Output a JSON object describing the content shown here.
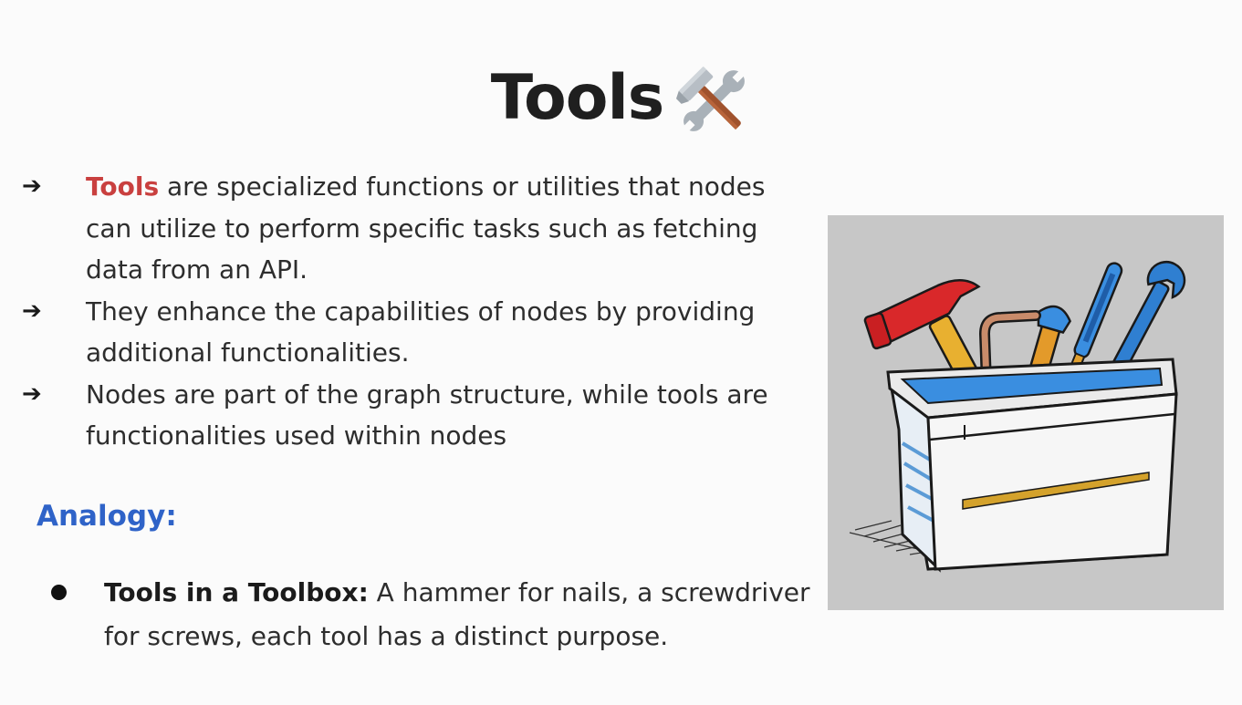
{
  "slide": {
    "title": "Tools",
    "title_icon": "hammer-and-wrench-icon",
    "bullets": [
      {
        "highlight": "Tools",
        "text": " are specialized functions or utilities that nodes can utilize to perform specific tasks such as fetching data from an API."
      },
      {
        "text": "They enhance the capabilities of nodes by providing additional functionalities."
      },
      {
        "text": "Nodes are part of the graph structure, while tools are functionalities used within nodes"
      }
    ],
    "bullet_marker": "➔",
    "analogy": {
      "heading": "Analogy",
      "colon": ":",
      "items": [
        {
          "term": "Tools in a Toolbox",
          "separator": ":",
          "text": " A hammer for nails, a screwdriver for screws, each tool has a distinct purpose."
        }
      ]
    },
    "image": {
      "subject": "toolbox-illustration"
    },
    "colors": {
      "highlight": "#c9403f",
      "analogy_heading": "#2f63c8",
      "background": "#fbfbfb",
      "image_background": "#c7c7c7"
    }
  }
}
